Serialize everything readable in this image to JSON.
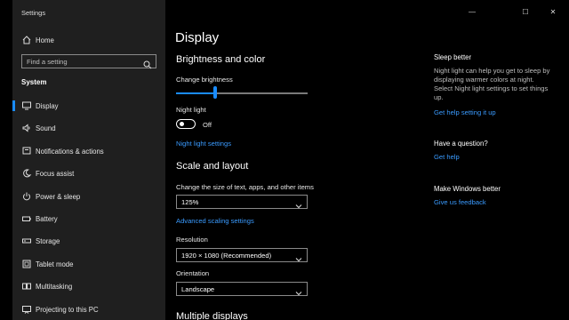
{
  "window": {
    "title": "Settings",
    "controls": {
      "minimize": "—",
      "maximize": "☐",
      "close": "✕"
    }
  },
  "sidebar": {
    "home": "Home",
    "search_placeholder": "Find a setting",
    "section": "System",
    "items": [
      {
        "label": "Display",
        "icon": "display-icon",
        "active": true
      },
      {
        "label": "Sound",
        "icon": "sound-icon"
      },
      {
        "label": "Notifications & actions",
        "icon": "notifications-icon"
      },
      {
        "label": "Focus assist",
        "icon": "focus-assist-icon"
      },
      {
        "label": "Power & sleep",
        "icon": "power-icon"
      },
      {
        "label": "Battery",
        "icon": "battery-icon"
      },
      {
        "label": "Storage",
        "icon": "storage-icon"
      },
      {
        "label": "Tablet mode",
        "icon": "tablet-icon"
      },
      {
        "label": "Multitasking",
        "icon": "multitasking-icon"
      },
      {
        "label": "Projecting to this PC",
        "icon": "projecting-icon"
      }
    ]
  },
  "main": {
    "title": "Display",
    "brightness": {
      "heading": "Brightness and color",
      "label": "Change brightness",
      "value": 0.3,
      "night_light_label": "Night light",
      "night_light_state": "Off",
      "night_light_link": "Night light settings"
    },
    "scale": {
      "heading": "Scale and layout",
      "size_label": "Change the size of text, apps, and other items",
      "size_value": "125%",
      "advanced_link": "Advanced scaling settings",
      "resolution_label": "Resolution",
      "resolution_value": "1920 × 1080 (Recommended)",
      "orientation_label": "Orientation",
      "orientation_value": "Landscape"
    },
    "multiple_displays_heading": "Multiple displays"
  },
  "right": {
    "sleep": {
      "title": "Sleep better",
      "text": "Night light can help you get to sleep by displaying warmer colors at night. Select Night light settings to set things up.",
      "link": "Get help setting it up"
    },
    "question": {
      "title": "Have a question?",
      "link": "Get help"
    },
    "better": {
      "title": "Make Windows better",
      "link": "Give us feedback"
    }
  },
  "colors": {
    "accent": "#1a8cff",
    "link": "#3a9bff",
    "sidebar_bg": "#1f1f1f"
  }
}
